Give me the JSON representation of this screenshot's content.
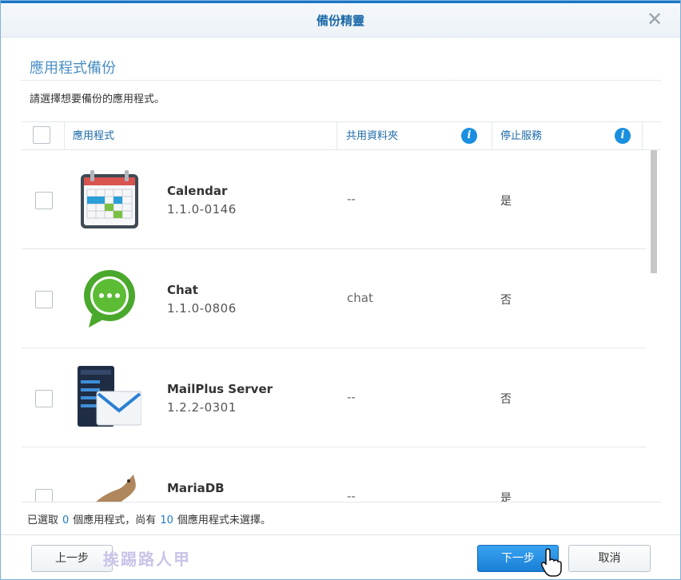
{
  "window": {
    "title": "備份精靈",
    "close_glyph": "✕"
  },
  "section": {
    "title": "應用程式備份",
    "instruction": "請選擇想要備份的應用程式。"
  },
  "table": {
    "headers": {
      "app": "應用程式",
      "shared_folder": "共用資料夾",
      "stop_service": "停止服務",
      "info_glyph": "i"
    },
    "rows": [
      {
        "name": "Calendar",
        "version": "1.1.0-0146",
        "shared_folder": "--",
        "stop_service": "是",
        "icon": "calendar-icon"
      },
      {
        "name": "Chat",
        "version": "1.1.0-0806",
        "shared_folder": "chat",
        "stop_service": "否",
        "icon": "chat-icon"
      },
      {
        "name": "MailPlus Server",
        "version": "1.2.2-0301",
        "shared_folder": "--",
        "stop_service": "否",
        "icon": "mailplus-server-icon"
      },
      {
        "name": "MariaDB",
        "version": "",
        "shared_folder": "--",
        "stop_service": "是",
        "icon": "mariadb-icon"
      }
    ]
  },
  "summary": {
    "prefix": "已選取",
    "selected_count": "0",
    "middle": "個應用程式，尚有",
    "unselected_count": "10",
    "suffix": "個應用程式未選擇。"
  },
  "buttons": {
    "back": "上一步",
    "next": "下一步",
    "cancel": "取消"
  },
  "watermark": "挨踢路人甲",
  "colors": {
    "accent": "#1c6aa8",
    "primary_button": "#1a7fd6",
    "info_icon": "#1a8fe0"
  }
}
